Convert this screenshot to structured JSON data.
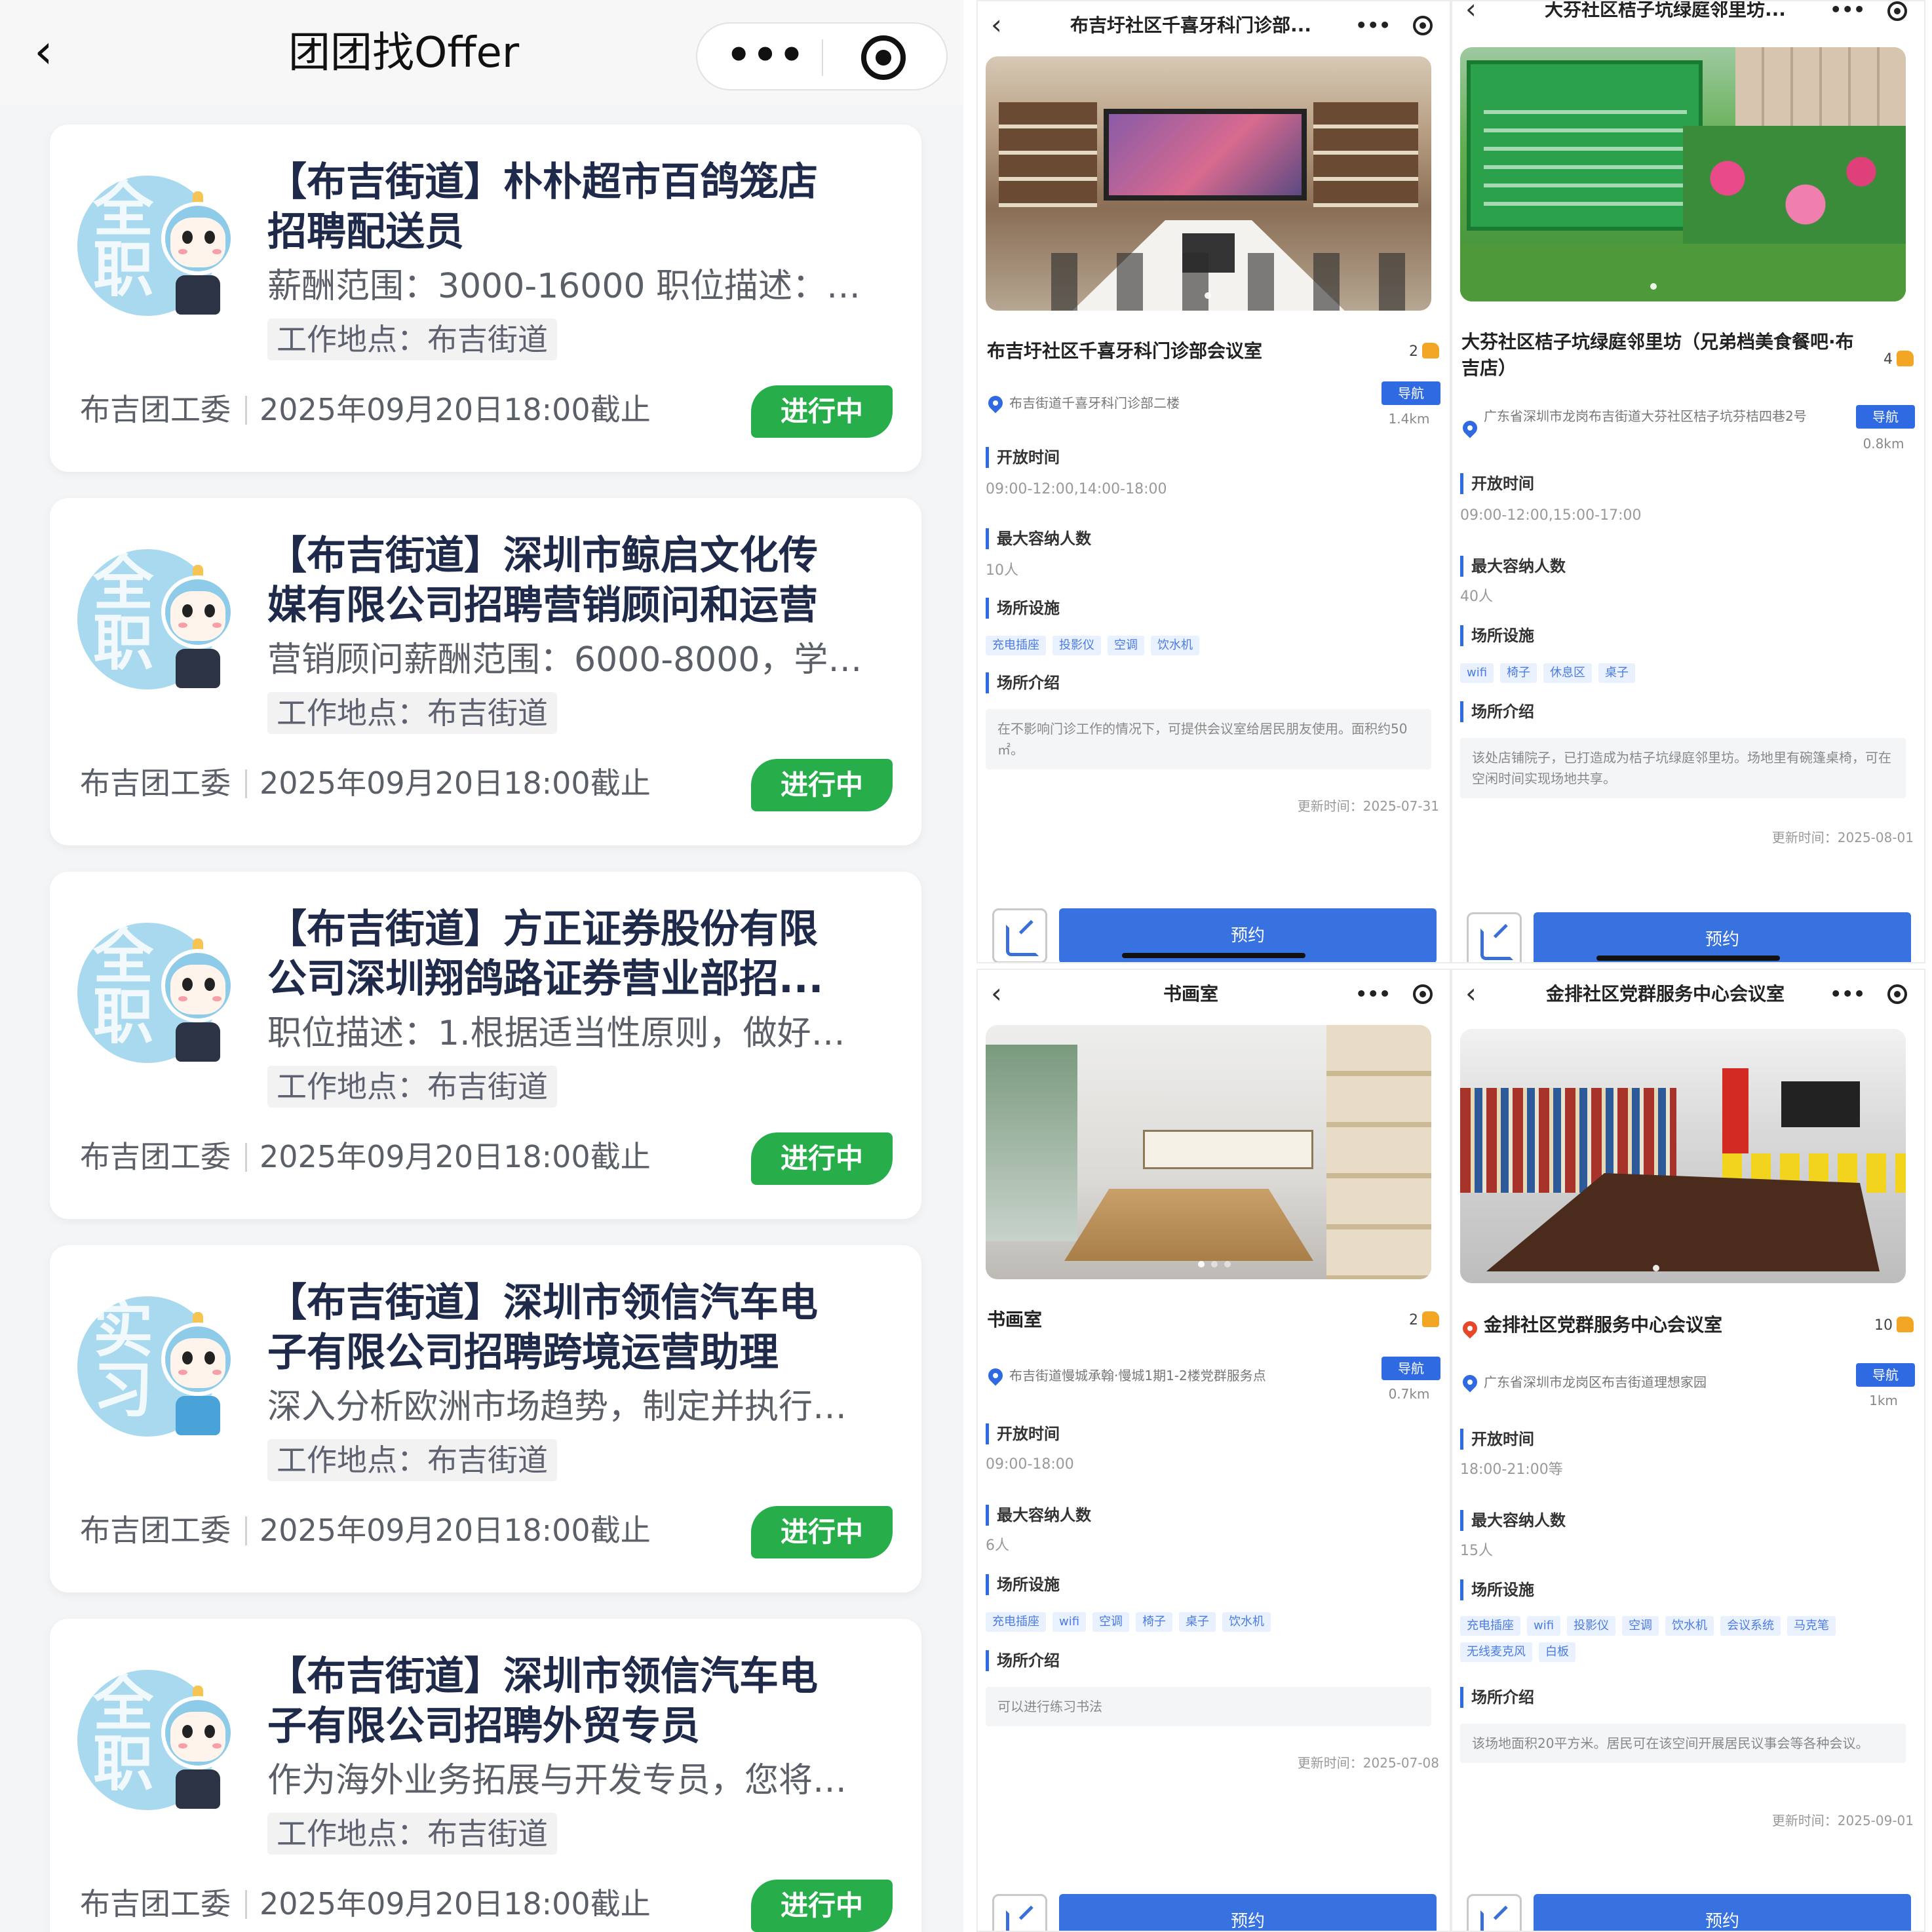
{
  "jobs_app": {
    "nav": {
      "back_icon": "‹",
      "title": "团团找Offer",
      "more_icon": "•••"
    },
    "jobs": [
      {
        "badge": "全职",
        "title_line1": "【布吉街道】朴朴超市百鸽笼店",
        "title_line2": "招聘配送员",
        "desc": "薪酬范围：3000-16000 职位描述：…",
        "location": "工作地点：布吉街道",
        "org": "布吉团工委",
        "deadline": "2025年09月20日18:00截止",
        "status": "进行中"
      },
      {
        "badge": "全职",
        "title_line1": "【布吉街道】深圳市鲸启文化传",
        "title_line2": "媒有限公司招聘营销顾问和运营",
        "desc": "营销顾问薪酬范围：6000-8000，学…",
        "location": "工作地点：布吉街道",
        "org": "布吉团工委",
        "deadline": "2025年09月20日18:00截止",
        "status": "进行中"
      },
      {
        "badge": "全职",
        "title_line1": "【布吉街道】方正证券股份有限",
        "title_line2": "公司深圳翔鸽路证券营业部招...",
        "desc": "职位描述：1.根据适当性原则，做好…",
        "location": "工作地点：布吉街道",
        "org": "布吉团工委",
        "deadline": "2025年09月20日18:00截止",
        "status": "进行中"
      },
      {
        "badge": "实习",
        "title_line1": "【布吉街道】深圳市领信汽车电",
        "title_line2": "子有限公司招聘跨境运营助理",
        "desc": "深入分析欧洲市场趋势，制定并执行…",
        "location": "工作地点：布吉街道",
        "org": "布吉团工委",
        "deadline": "2025年09月20日18:00截止",
        "status": "进行中"
      },
      {
        "badge": "全职",
        "title_line1": "【布吉街道】深圳市领信汽车电",
        "title_line2": "子有限公司招聘外贸专员",
        "desc": "作为海外业务拓展与开发专员，您将…",
        "location": "工作地点：布吉街道",
        "org": "布吉团工委",
        "deadline": "2025年09月20日18:00截止",
        "status": "进行中"
      }
    ]
  },
  "venues": [
    {
      "nav_title": "布吉圩社区千喜牙科门诊部...",
      "name": "布吉圩社区千喜牙科门诊部会议室",
      "likes": "2",
      "address": "布吉街道千喜牙科门诊部二楼",
      "nav_label": "导航",
      "distance": "1.4km",
      "hours_label": "开放时间",
      "hours": "09:00-12:00,14:00-18:00",
      "capacity_label": "最大容纳人数",
      "capacity": "10人",
      "facilities_label": "场所设施",
      "facilities": [
        "充电插座",
        "投影仪",
        "空调",
        "饮水机"
      ],
      "intro_label": "场所介绍",
      "intro": "在不影响门诊工作的情况下，可提供会议室给居民朋友使用。面积约50㎡。",
      "updated": "更新时间：2025-07-31",
      "book_label": "预约"
    },
    {
      "nav_title": "大芬社区桔子坑绿庭邻里坊...",
      "name": "大芬社区桔子坑绿庭邻里坊（兄弟档美食餐吧·布吉店）",
      "likes": "4",
      "address": "广东省深圳市龙岗布吉街道大芬社区桔子坑芬桔四巷2号",
      "nav_label": "导航",
      "distance": "0.8km",
      "hours_label": "开放时间",
      "hours": "09:00-12:00,15:00-17:00",
      "capacity_label": "最大容纳人数",
      "capacity": "40人",
      "facilities_label": "场所设施",
      "facilities": [
        "wifi",
        "椅子",
        "休息区",
        "桌子"
      ],
      "intro_label": "场所介绍",
      "intro": "该处店铺院子，已打造成为桔子坑绿庭邻里坊。场地里有碗篷桌椅，可在空闲时间实现场地共享。",
      "updated": "更新时间：2025-08-01",
      "book_label": "预约"
    },
    {
      "nav_title": "书画室",
      "name": "书画室",
      "likes": "2",
      "address": "布吉街道慢城承翰·慢城1期1-2楼党群服务点",
      "nav_label": "导航",
      "distance": "0.7km",
      "hours_label": "开放时间",
      "hours": "09:00-18:00",
      "capacity_label": "最大容纳人数",
      "capacity": "6人",
      "facilities_label": "场所设施",
      "facilities": [
        "充电插座",
        "wifi",
        "空调",
        "椅子",
        "桌子",
        "饮水机"
      ],
      "intro_label": "场所介绍",
      "intro": "可以进行练习书法",
      "updated": "更新时间：2025-07-08",
      "book_label": "预约"
    },
    {
      "nav_title": "金排社区党群服务中心会议室",
      "name": "金排社区党群服务中心会议室",
      "likes": "10",
      "address": "广东省深圳市龙岗区布吉街道理想家园",
      "nav_label": "导航",
      "distance": "1km",
      "hours_label": "开放时间",
      "hours": "18:00-21:00等",
      "capacity_label": "最大容纳人数",
      "capacity": "15人",
      "facilities_label": "场所设施",
      "facilities": [
        "充电插座",
        "wifi",
        "投影仪",
        "空调",
        "饮水机",
        "会议系统",
        "马克笔",
        "无线麦克风",
        "白板"
      ],
      "intro_label": "场所介绍",
      "intro": "该场地面积20平方米。居民可在该空间开展居民议事会等各种会议。",
      "updated": "更新时间：2025-09-01",
      "book_label": "预约"
    }
  ]
}
